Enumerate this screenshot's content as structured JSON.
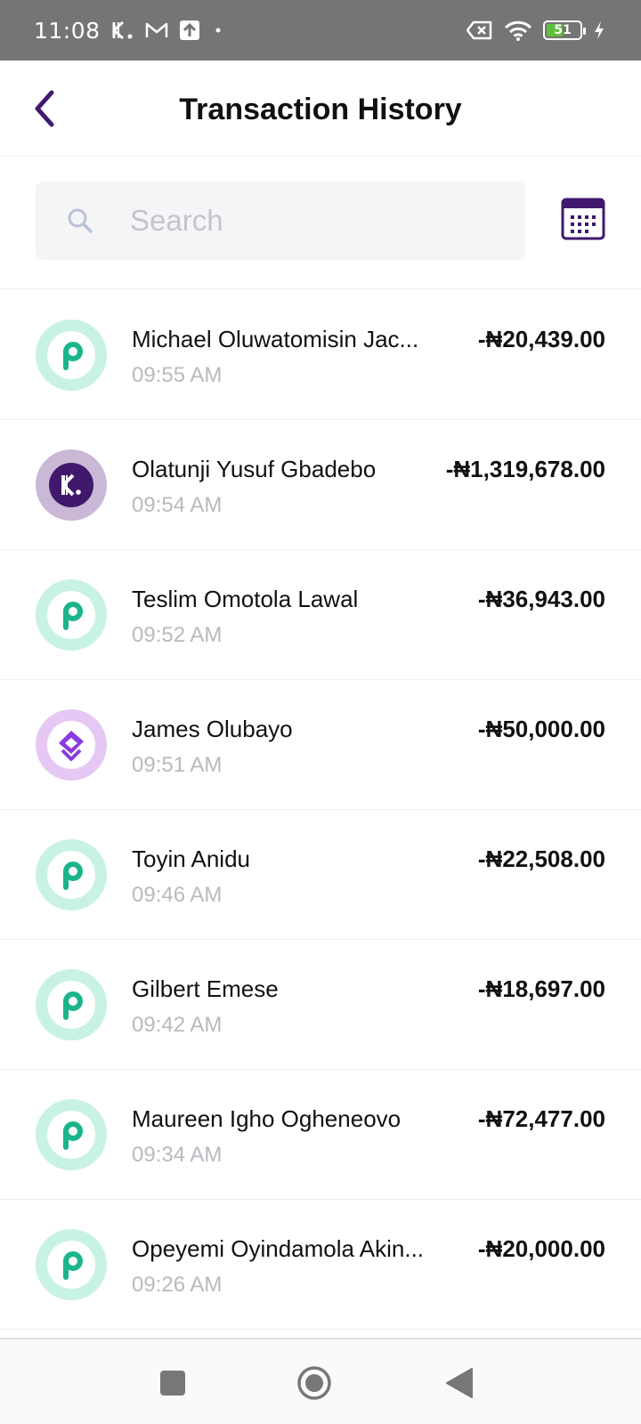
{
  "status_bar": {
    "time": "11:08",
    "battery_level": "51",
    "battery_fraction": 0.51,
    "icons": [
      "kuda-notification-icon",
      "gmail-icon",
      "upload-icon",
      "dot-icon",
      "battery-saver-icon",
      "wifi-icon",
      "battery-icon",
      "charging-icon"
    ]
  },
  "header": {
    "title": "Transaction History",
    "back_icon": "chevron-left-icon"
  },
  "search": {
    "placeholder": "Search",
    "value": "",
    "icon": "search-icon"
  },
  "calendar": {
    "icon": "calendar-icon"
  },
  "colors": {
    "accent": "#40196d",
    "palmpay_ring": "#c8f2e4",
    "palmpay_fill": "#1bb58c",
    "kuda_ring": "#c9b8d6",
    "kuda_fill": "#40196d",
    "opay_ring": "#e5c9f4",
    "opay_fill": "#8a3ae0"
  },
  "transactions": [
    {
      "name": "Michael Oluwatomisin Jac...",
      "time": "09:55 AM",
      "amount": "-₦20,439.00",
      "provider": "palmpay"
    },
    {
      "name": "Olatunji Yusuf Gbadebo",
      "time": "09:54 AM",
      "amount": "-₦1,319,678.00",
      "provider": "kuda"
    },
    {
      "name": "Teslim Omotola Lawal",
      "time": "09:52 AM",
      "amount": "-₦36,943.00",
      "provider": "palmpay"
    },
    {
      "name": "James Olubayo",
      "time": "09:51 AM",
      "amount": "-₦50,000.00",
      "provider": "moniepoint"
    },
    {
      "name": "Toyin Anidu",
      "time": "09:46 AM",
      "amount": "-₦22,508.00",
      "provider": "palmpay"
    },
    {
      "name": "Gilbert Emese",
      "time": "09:42 AM",
      "amount": "-₦18,697.00",
      "provider": "palmpay"
    },
    {
      "name": "Maureen Igho Ogheneovo",
      "time": "09:34 AM",
      "amount": "-₦72,477.00",
      "provider": "palmpay"
    },
    {
      "name": "Opeyemi Oyindamola Akin...",
      "time": "09:26 AM",
      "amount": "-₦20,000.00",
      "provider": "palmpay"
    }
  ],
  "nav": {
    "recents_icon": "square-icon",
    "home_icon": "circle-icon",
    "back_icon": "triangle-back-icon"
  }
}
